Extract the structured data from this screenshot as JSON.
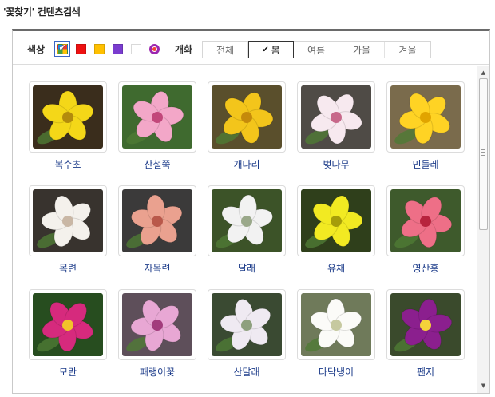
{
  "title": "'꽃찾기' 컨텐츠검색",
  "filters": {
    "color_label": "색상",
    "season_label": "개화",
    "colors": [
      {
        "name": "all-colors",
        "hex": "multi",
        "selected": true
      },
      {
        "name": "red",
        "hex": "#ee1111",
        "selected": false
      },
      {
        "name": "yellow",
        "hex": "#ffc000",
        "selected": false
      },
      {
        "name": "purple",
        "hex": "#7a3ccf",
        "selected": false
      },
      {
        "name": "white",
        "hex": "#ffffff",
        "selected": false
      },
      {
        "name": "other",
        "hex": "#9c27b0",
        "selected": false
      }
    ],
    "seasons": [
      {
        "label": "전체",
        "active": false
      },
      {
        "label": "봄",
        "active": true
      },
      {
        "label": "여름",
        "active": false
      },
      {
        "label": "가을",
        "active": false
      },
      {
        "label": "겨울",
        "active": false
      }
    ],
    "check_icon": "✔"
  },
  "flowers": [
    {
      "name": "복수초",
      "icon": "yellow-flower",
      "bg": "#3a2d1c",
      "petal": "#f4d718",
      "center": "#b38b0c"
    },
    {
      "name": "산철쭉",
      "icon": "pink-flower",
      "bg": "#3f6a2f",
      "petal": "#f3a7c8",
      "center": "#c2477a"
    },
    {
      "name": "개나리",
      "icon": "yellow-flower",
      "bg": "#5a4f2c",
      "petal": "#f3c51b",
      "center": "#c58a0b"
    },
    {
      "name": "벚나무",
      "icon": "white-flower",
      "bg": "#4f4b46",
      "petal": "#f7e9ef",
      "center": "#c7688a"
    },
    {
      "name": "민들레",
      "icon": "yellow-flower",
      "bg": "#7a6b4c",
      "petal": "#ffd324",
      "center": "#e1a400"
    },
    {
      "name": "목련",
      "icon": "white-flower",
      "bg": "#38332e",
      "petal": "#f4f1ec",
      "center": "#c9b7a5"
    },
    {
      "name": "자목련",
      "icon": "pink-flower",
      "bg": "#3b3a3a",
      "petal": "#eaa18f",
      "center": "#b9584a"
    },
    {
      "name": "달래",
      "icon": "white-flower",
      "bg": "#3c5328",
      "petal": "#f2f2f2",
      "center": "#9aa88a"
    },
    {
      "name": "유채",
      "icon": "yellow-flower",
      "bg": "#2f3f1b",
      "petal": "#f2ea22",
      "center": "#a69d0a"
    },
    {
      "name": "영산홍",
      "icon": "red-flower",
      "bg": "#3e5a2c",
      "petal": "#ee6f87",
      "center": "#b8243e"
    },
    {
      "name": "모란",
      "icon": "magenta-flower",
      "bg": "#274d1f",
      "petal": "#d62a7d",
      "center": "#f2c22a"
    },
    {
      "name": "패랭이꽃",
      "icon": "pink-flower",
      "bg": "#5e4f5a",
      "petal": "#e8a7d4",
      "center": "#a23c7c"
    },
    {
      "name": "산달래",
      "icon": "white-flower",
      "bg": "#3a4a32",
      "petal": "#efeaf2",
      "center": "#8ea07e"
    },
    {
      "name": "다닥냉이",
      "icon": "white-flower",
      "bg": "#6f7a5a",
      "petal": "#fbfbf8",
      "center": "#c6c9a0"
    },
    {
      "name": "팬지",
      "icon": "purple-flower",
      "bg": "#3a4a2c",
      "petal": "#8b1f8e",
      "center": "#f5d23a"
    }
  ],
  "scrollbar": {
    "up_icon": "▲",
    "down_icon": "▼"
  }
}
